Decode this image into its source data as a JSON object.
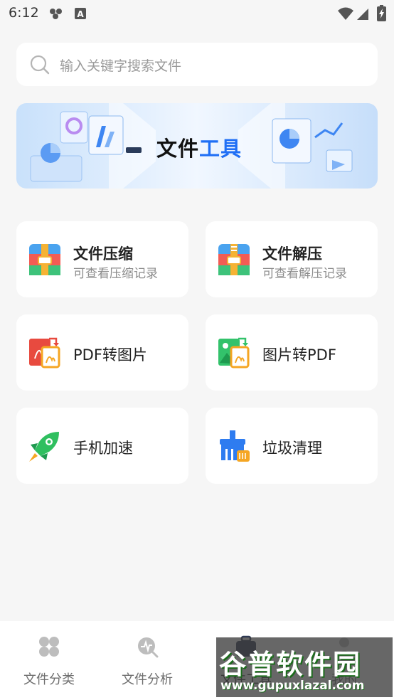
{
  "status_bar": {
    "time": "6:12"
  },
  "search": {
    "placeholder": "输入关键字搜索文件"
  },
  "banner": {
    "title_part1": "文件",
    "title_part2": "工具"
  },
  "tools": [
    {
      "title": "文件压缩",
      "subtitle": "可查看压缩记录",
      "icon": "zip-compress-icon"
    },
    {
      "title": "文件解压",
      "subtitle": "可查看解压记录",
      "icon": "zip-extract-icon"
    },
    {
      "title": "PDF转图片",
      "icon": "pdf-to-image-icon"
    },
    {
      "title": "图片转PDF",
      "icon": "image-to-pdf-icon"
    },
    {
      "title": "手机加速",
      "icon": "rocket-icon"
    },
    {
      "title": "垃圾清理",
      "icon": "broom-icon"
    }
  ],
  "bottom_nav": [
    {
      "label": "文件分类",
      "icon": "grid-icon"
    },
    {
      "label": "文件分析",
      "icon": "analysis-icon"
    },
    {
      "label": "文件工具",
      "icon": "toolbox-icon",
      "active": true
    },
    {
      "label": "我的",
      "icon": "profile-icon"
    }
  ],
  "watermark": {
    "text": "谷普软件园",
    "url": "www.gupuxlazal.com"
  },
  "colors": {
    "accent": "#1f6ff5",
    "background": "#f6f6f6"
  }
}
